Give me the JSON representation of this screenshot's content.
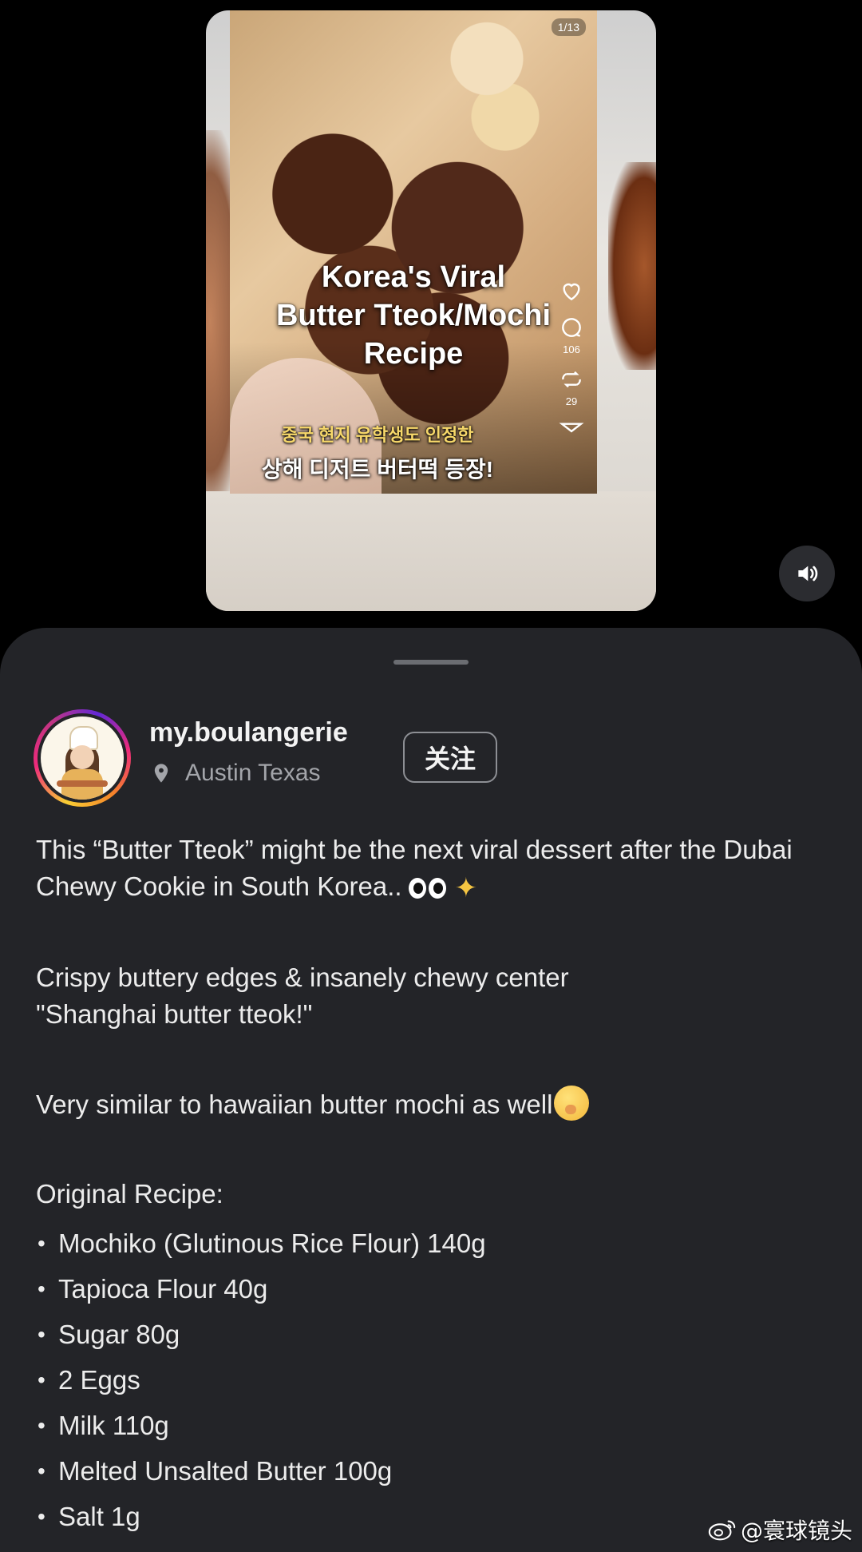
{
  "media": {
    "slide_counter": "1/13",
    "overlay_title_lines": [
      "Korea's Viral",
      "Butter Tteok/Mochi",
      "Recipe"
    ],
    "korean_subtitle": "중국 현지 유학생도 인정한",
    "korean_main": "상해 디저트 버터떡 등장!",
    "actions": {
      "like_icon": "heart-icon",
      "comment_count": "106",
      "repost_count": "29"
    },
    "sound_icon": "speaker-icon"
  },
  "profile": {
    "username": "my.boulangerie",
    "location": "Austin Texas",
    "follow_label": "关注"
  },
  "caption": {
    "line1": "This “Butter Tteok” might be the next viral dessert after the Dubai Chewy Cookie in South Korea..",
    "line2a": "Crispy buttery edges &  insanely chewy center",
    "line2b": "\"Shanghai butter tteok!\"",
    "line3": "Very similar to hawaiian butter mochi as well",
    "recipe_title": "Original Recipe:",
    "ingredients": [
      "Mochiko (Glutinous Rice Flour) 140g",
      "Tapioca Flour 40g",
      "Sugar 80g",
      "2 Eggs",
      "Milk 110g",
      "Melted Unsalted Butter 100g",
      "Salt 1g"
    ]
  },
  "watermark": "@寰球镜头",
  "colors": {
    "sheet_bg": "#232428",
    "page_bg": "#000000",
    "secondary_text": "#a3a5aa"
  }
}
